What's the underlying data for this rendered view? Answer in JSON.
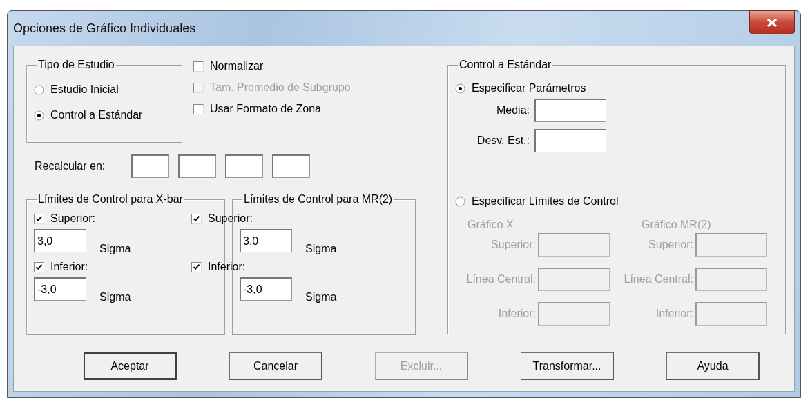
{
  "window": {
    "title": "Opciones de Gráfico Individuales"
  },
  "study_type": {
    "title": "Tipo de Estudio",
    "options": [
      {
        "label": "Estudio Inicial",
        "selected": false
      },
      {
        "label": "Control a Estándar",
        "selected": true
      }
    ]
  },
  "options": [
    {
      "label": "Normalizar",
      "checked": false,
      "disabled": false
    },
    {
      "label": "Tam. Promedio de Subgrupo",
      "checked": false,
      "disabled": true
    },
    {
      "label": "Usar Formato de Zona",
      "checked": false,
      "disabled": false
    }
  ],
  "recalculate": {
    "label": "Recalcular en:",
    "fields": [
      {
        "kind": "text"
      },
      {
        "kind": "text"
      },
      {
        "kind": "text"
      },
      {
        "kind": "text"
      }
    ]
  },
  "limit_groups": [
    {
      "title": "Límites de Control para X-bar",
      "rows": [
        {
          "label": "Superior:",
          "checked": true,
          "value": "3,0",
          "unit": "Sigma"
        },
        {
          "label": "Inferior:",
          "checked": true,
          "value": "-3,0",
          "unit": "Sigma"
        }
      ]
    },
    {
      "title": "Límites de Control para MR(2)",
      "rows": [
        {
          "label": "Superior:",
          "checked": true,
          "value": "3,0",
          "unit": "Sigma"
        },
        {
          "label": "Inferior:",
          "checked": true,
          "value": "-3,0",
          "unit": "Sigma"
        }
      ]
    }
  ],
  "standard": {
    "title": "Control a Estándar",
    "param_option": {
      "label": "Especificar Parámetros",
      "selected": true
    },
    "params": [
      {
        "label": "Media:"
      },
      {
        "label": "Desv. Est.:"
      }
    ],
    "limits_option": {
      "label": "Especificar Límites de Control",
      "selected": false
    },
    "charts": [
      {
        "title": "Gráfico X",
        "disabled": true,
        "fields": [
          {
            "label": "Superior:"
          },
          {
            "label": "Línea Central:"
          },
          {
            "label": "Inferior:"
          }
        ]
      },
      {
        "title": "Gráfico MR(2)",
        "disabled": true,
        "fields": [
          {
            "label": "Superior:"
          },
          {
            "label": "Línea Central:"
          },
          {
            "label": "Inferior:"
          }
        ]
      }
    ]
  },
  "buttons": [
    {
      "label": "Aceptar",
      "disabled": false,
      "default": true
    },
    {
      "label": "Cancelar",
      "disabled": false,
      "default": false
    },
    {
      "label": "Excluir...",
      "disabled": true,
      "default": false
    },
    {
      "label": "Transformar...",
      "disabled": false,
      "default": false
    },
    {
      "label": "Ayuda",
      "disabled": false,
      "default": false
    }
  ]
}
